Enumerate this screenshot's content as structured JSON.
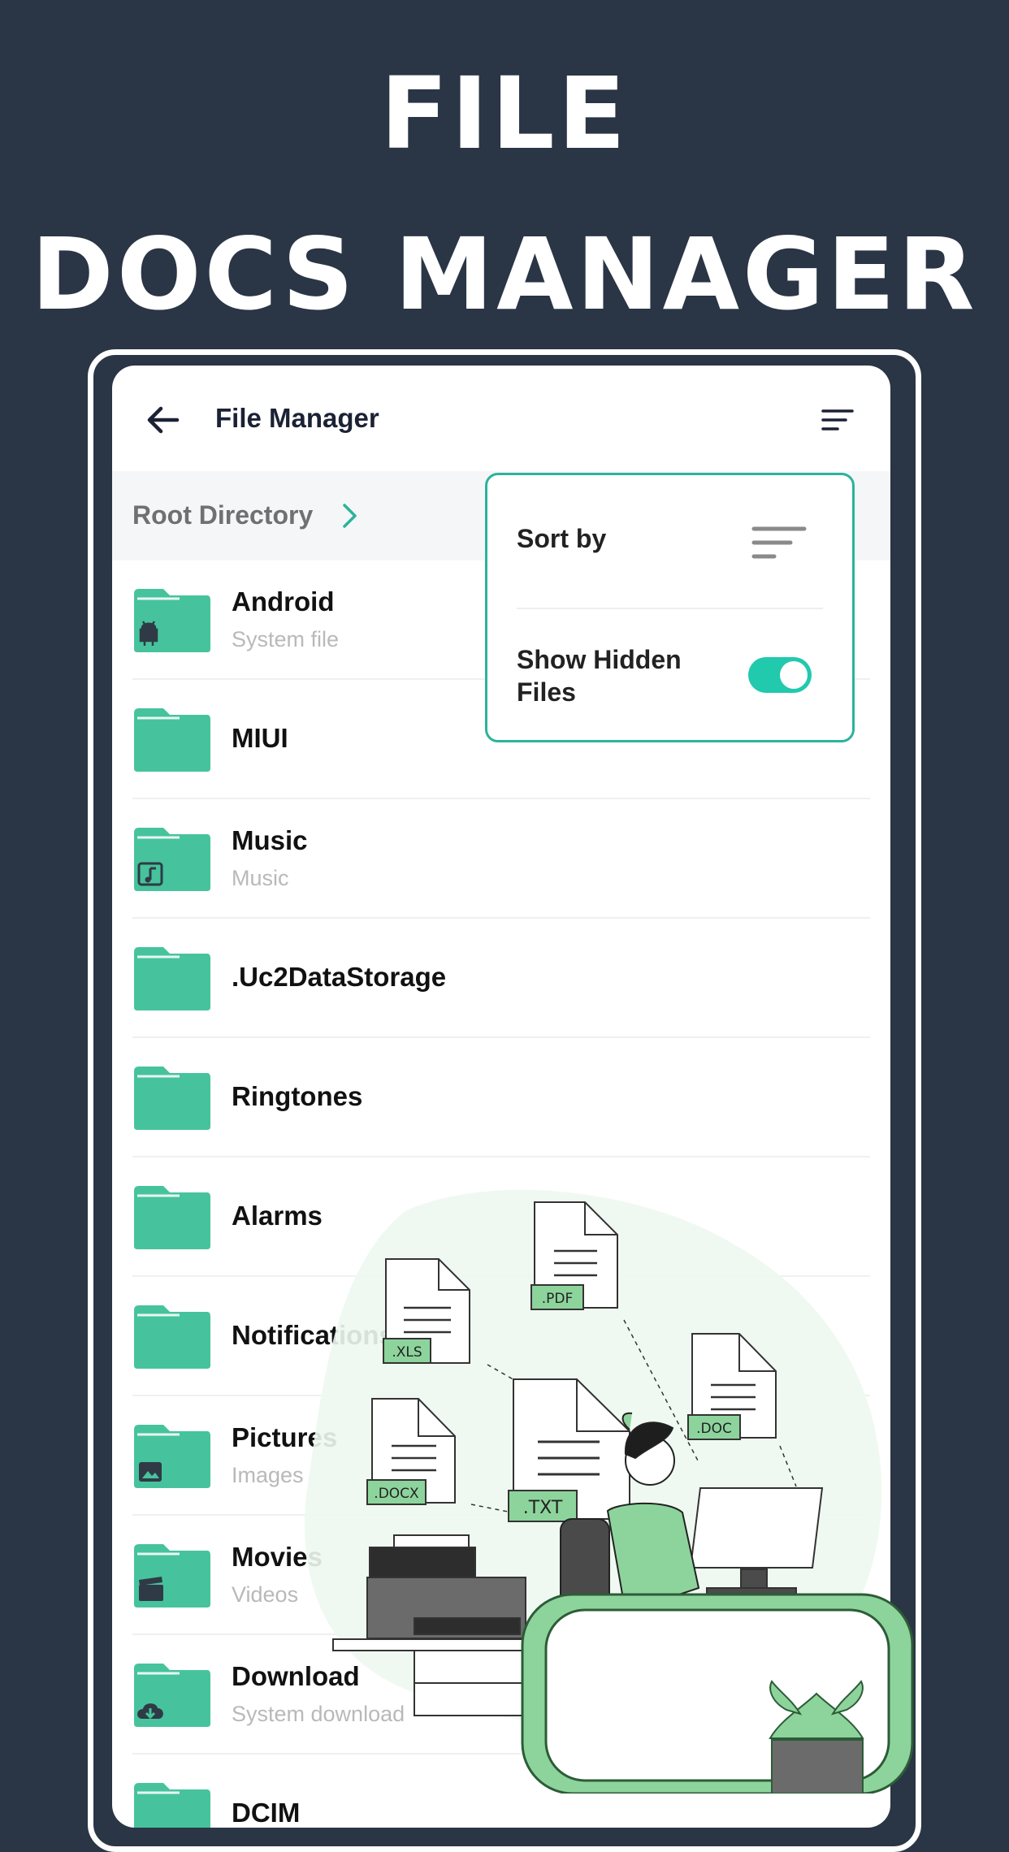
{
  "promo": {
    "line1": "FILE",
    "line2": "DOCS MANAGER"
  },
  "app": {
    "title": "File Manager",
    "back_icon": "arrow-left-icon",
    "sort_icon": "sort-lines-icon"
  },
  "breadcrumb": {
    "label": "Root Directory"
  },
  "popup": {
    "sort_label": "Sort by",
    "hidden_label": "Show Hidden Files",
    "hidden_enabled": true
  },
  "files": [
    {
      "name": "Android",
      "subtitle": "System file",
      "badge": "android-icon"
    },
    {
      "name": "MIUI",
      "subtitle": "",
      "badge": ""
    },
    {
      "name": "Music",
      "subtitle": "Music",
      "badge": "music-icon"
    },
    {
      "name": ".Uc2DataStorage",
      "subtitle": "",
      "badge": ""
    },
    {
      "name": "Ringtones",
      "subtitle": "",
      "badge": ""
    },
    {
      "name": "Alarms",
      "subtitle": "",
      "badge": ""
    },
    {
      "name": "Notifications",
      "subtitle": "",
      "badge": ""
    },
    {
      "name": "Pictures",
      "subtitle": "Images",
      "badge": "image-icon"
    },
    {
      "name": "Movies",
      "subtitle": "Videos",
      "badge": "video-icon"
    },
    {
      "name": "Download",
      "subtitle": "System download",
      "badge": "download-icon"
    },
    {
      "name": "DCIM",
      "subtitle": "",
      "badge": ""
    }
  ],
  "illustration": {
    "doc_labels": [
      ".XLS",
      ".PDF",
      ".DOC",
      ".DOCX",
      ".TXT"
    ]
  },
  "colors": {
    "background": "#2a3545",
    "folder": "#46c39c",
    "accent": "#2bb39b",
    "toggle": "#21c9ad",
    "illustration_green": "#8dd49c"
  }
}
